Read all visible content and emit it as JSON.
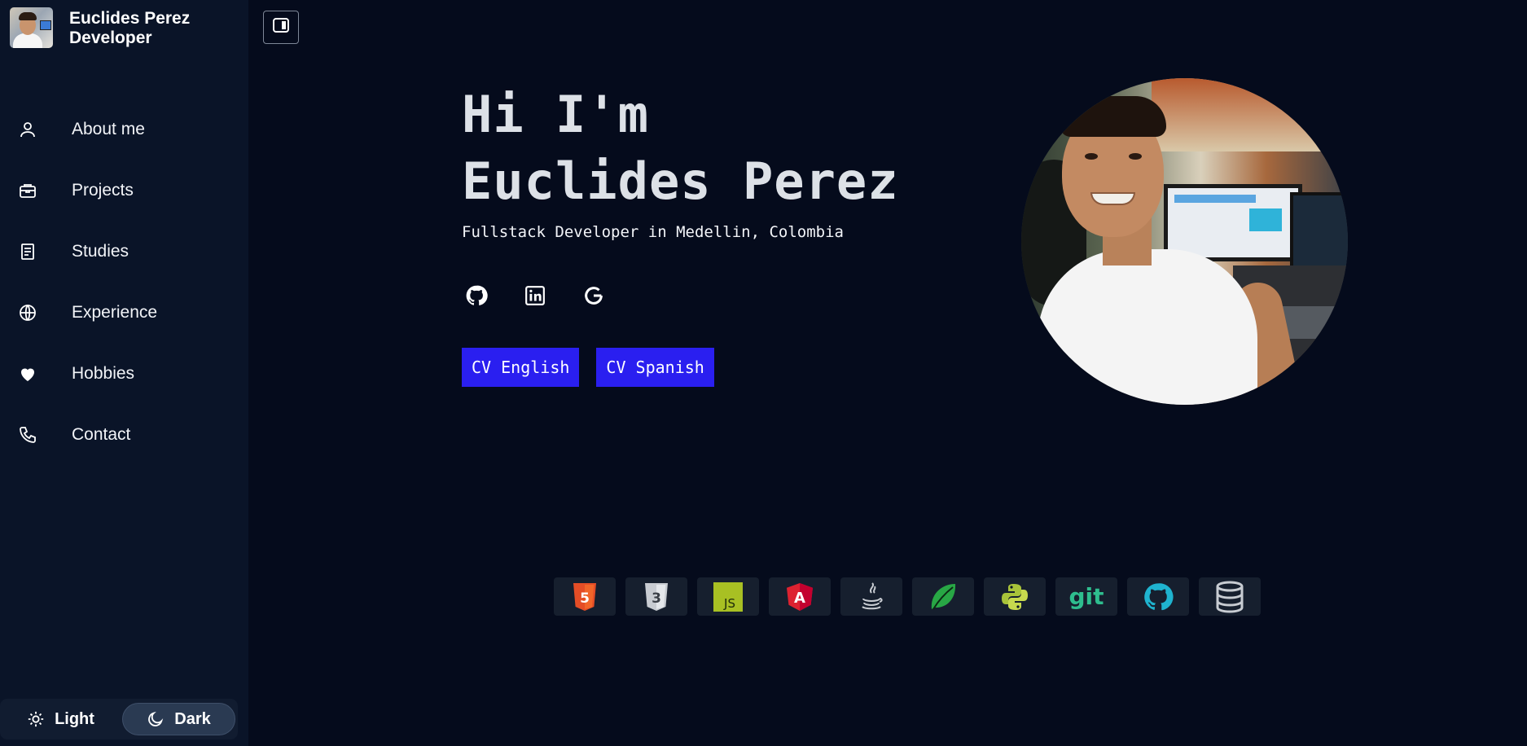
{
  "brand": {
    "name_line1": "Euclides Perez",
    "name_line2": "Developer"
  },
  "nav": {
    "items": [
      {
        "label": "About me",
        "icon": "user-icon"
      },
      {
        "label": "Projects",
        "icon": "briefcase-icon"
      },
      {
        "label": "Studies",
        "icon": "document-icon"
      },
      {
        "label": "Experience",
        "icon": "globe-icon"
      },
      {
        "label": "Hobbies",
        "icon": "heart-icon"
      },
      {
        "label": "Contact",
        "icon": "phone-icon"
      }
    ]
  },
  "theme": {
    "light_label": "Light",
    "dark_label": "Dark",
    "selected": "Dark"
  },
  "hero": {
    "greeting": "Hi I'm",
    "name": "Euclides Perez",
    "subtitle": "Fullstack Developer in Medellin, Colombia",
    "socials": [
      "github-icon",
      "linkedin-icon",
      "google-icon"
    ],
    "cv_english_label": "CV English",
    "cv_spanish_label": "CV Spanish"
  },
  "tech_stack": {
    "items": [
      {
        "icon": "html5-icon",
        "label": "5",
        "color": "#e44d26"
      },
      {
        "icon": "css3-icon",
        "label": "3",
        "color": "#c8ccd2"
      },
      {
        "icon": "javascript-icon",
        "label": "JS",
        "color": "#a8c023"
      },
      {
        "icon": "angular-icon",
        "label": "A",
        "color": "#dd2230"
      },
      {
        "icon": "java-icon",
        "label": "",
        "color": "#c8ccd2"
      },
      {
        "icon": "spring-leaf-icon",
        "label": "",
        "color": "#28a745"
      },
      {
        "icon": "python-icon",
        "label": "",
        "color": "#a9c33a"
      },
      {
        "icon": "git-icon",
        "label": "git",
        "color": "#2ebd8e"
      },
      {
        "icon": "github-icon",
        "label": "",
        "color": "#1fb3cf"
      },
      {
        "icon": "database-icon",
        "label": "",
        "color": "#c8ccd2"
      }
    ]
  },
  "colors": {
    "background": "#050b1c",
    "sidebar": "#0a1428",
    "cv_button": "#2a1ff0",
    "heading": "#dde1e7"
  }
}
